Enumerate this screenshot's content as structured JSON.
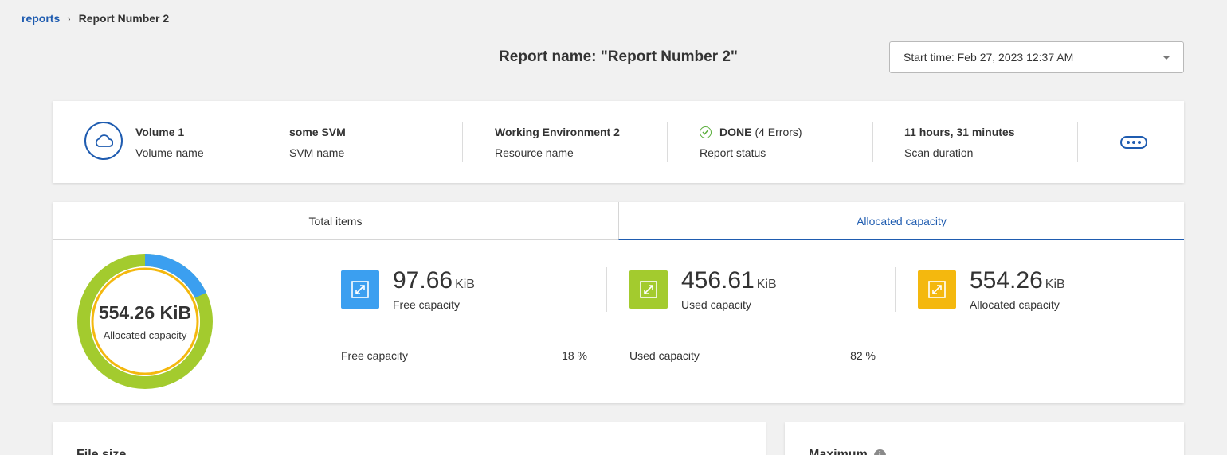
{
  "breadcrumb": {
    "root": "reports",
    "separator": "›",
    "current": "Report Number 2"
  },
  "report_title": "Report name: \"Report Number 2\"",
  "start_time": {
    "label": "Start time: Feb 27, 2023 12:37 AM"
  },
  "summary": {
    "volume": {
      "value": "Volume 1",
      "label": "Volume name",
      "icon": "cloud-icon"
    },
    "svm": {
      "value": "some SVM",
      "label": "SVM name"
    },
    "resource": {
      "value": "Working Environment 2",
      "label": "Resource name"
    },
    "status": {
      "value": "DONE",
      "errors": "(4 Errors)",
      "label": "Report status",
      "icon": "check-circle-icon"
    },
    "duration": {
      "value": "11 hours, 31 minutes",
      "label": "Scan duration"
    }
  },
  "tabs": {
    "total": "Total items",
    "allocated": "Allocated capacity",
    "active": "allocated"
  },
  "donut": {
    "value": "554.26 KiB",
    "label": "Allocated capacity",
    "free_fraction": 0.18,
    "used_fraction": 0.82
  },
  "metrics": {
    "free": {
      "number": "97.66",
      "unit": "KiB",
      "label": "Free capacity",
      "foot_label": "Free capacity",
      "percent": "18 %"
    },
    "used": {
      "number": "456.61",
      "unit": "KiB",
      "label": "Used capacity",
      "foot_label": "Used capacity",
      "percent": "82 %"
    },
    "allocated": {
      "number": "554.26",
      "unit": "KiB",
      "label": "Allocated capacity"
    }
  },
  "colors": {
    "accent": "#1f5cb0",
    "free": "#3b9ff0",
    "used": "#a3cb2e",
    "allocated": "#f4b80e"
  },
  "bottom": {
    "left_title": "File size",
    "right_title": "Maximum"
  }
}
